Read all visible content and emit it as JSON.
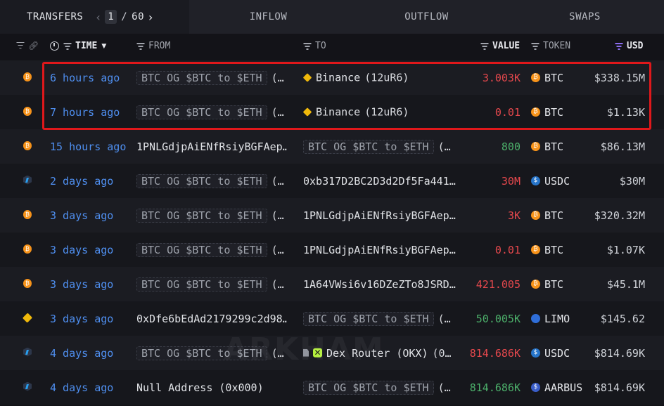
{
  "tabs": {
    "transfers": "TRANSFERS",
    "page_current": "1",
    "page_sep": "/",
    "page_total": "60",
    "inflow": "INFLOW",
    "outflow": "OUTFLOW",
    "swaps": "SWAPS"
  },
  "headers": {
    "time": "TIME",
    "from": "FROM",
    "to": "TO",
    "value": "VALUE",
    "token": "TOKEN",
    "usd": "USD"
  },
  "watermark": "ARKHAM",
  "colors": {
    "time_link": "#4f8ff0",
    "outflow_value": "#e5484d",
    "inflow_value": "#4caf6a",
    "highlight_box": "#e0181b",
    "background": "#131318"
  },
  "rows": [
    {
      "chain": "bitcoin",
      "time": "6 hours ago",
      "from_pill": "BTC OG $BTC to $ETH",
      "from_extra": "(…",
      "to_icon": "binance",
      "to_name": "Binance",
      "to_extra": "(12uR6)",
      "value": "3.003K",
      "value_color": "red",
      "token_icon": "btc",
      "token": "BTC",
      "usd": "$338.15M"
    },
    {
      "chain": "bitcoin",
      "time": "7 hours ago",
      "from_pill": "BTC OG $BTC to $ETH",
      "from_extra": "(…",
      "to_icon": "binance",
      "to_name": "Binance",
      "to_extra": "(12uR6)",
      "value": "0.01",
      "value_color": "red",
      "token_icon": "btc",
      "token": "BTC",
      "usd": "$1.13K"
    },
    {
      "chain": "bitcoin",
      "time": "15 hours ago",
      "from_addr": "1PNLGdjpAiENfRsiyBGFAep…",
      "to_pill": "BTC OG $BTC to $ETH",
      "to_extra": "(…",
      "value": "800",
      "value_color": "green",
      "token_icon": "btc",
      "token": "BTC",
      "usd": "$86.13M"
    },
    {
      "chain": "arbitrum",
      "time": "2 days ago",
      "from_pill": "BTC OG $BTC to $ETH",
      "from_extra": "(…",
      "to_addr": "0xb317D2BC2D3d2Df5Fa441…",
      "value": "30M",
      "value_color": "red",
      "token_icon": "usdc",
      "token": "USDC",
      "usd": "$30M"
    },
    {
      "chain": "bitcoin",
      "time": "3 days ago",
      "from_pill": "BTC OG $BTC to $ETH",
      "from_extra": "(…",
      "to_addr": "1PNLGdjpAiENfRsiyBGFAep…",
      "value": "3K",
      "value_color": "red",
      "token_icon": "btc",
      "token": "BTC",
      "usd": "$320.32M"
    },
    {
      "chain": "bitcoin",
      "time": "3 days ago",
      "from_pill": "BTC OG $BTC to $ETH",
      "from_extra": "(…",
      "to_addr": "1PNLGdjpAiENfRsiyBGFAep…",
      "value": "0.01",
      "value_color": "red",
      "token_icon": "btc",
      "token": "BTC",
      "usd": "$1.07K"
    },
    {
      "chain": "bitcoin",
      "time": "3 days ago",
      "from_pill": "BTC OG $BTC to $ETH",
      "from_extra": "(…",
      "to_addr": "1A64VWsi6v16DZeZTo8JSRD…",
      "value": "421.005",
      "value_color": "red",
      "token_icon": "btc",
      "token": "BTC",
      "usd": "$45.1M"
    },
    {
      "chain": "bsc",
      "time": "3 days ago",
      "from_addr": "0xDfe6bEdAd2179299c2d98…",
      "to_pill": "BTC OG $BTC to $ETH",
      "to_extra": "(…",
      "value": "50.005K",
      "value_color": "green",
      "token_icon": "limo",
      "token": "LIMO",
      "usd": "$145.62"
    },
    {
      "chain": "arbitrum",
      "time": "4 days ago",
      "from_pill": "BTC OG $BTC to $ETH",
      "from_extra": "(…",
      "to_icon": "okx",
      "to_name": "Dex Router (OKX)",
      "to_extra": "(0…",
      "value": "814.686K",
      "value_color": "red",
      "token_icon": "usdc",
      "token": "USDC",
      "usd": "$814.69K"
    },
    {
      "chain": "arbitrum",
      "time": "4 days ago",
      "from_addr": "Null Address (0x000)",
      "to_pill": "BTC OG $BTC to $ETH",
      "to_extra": "(…",
      "value": "814.686K",
      "value_color": "green",
      "token_icon": "aarbus",
      "token": "AARBUS",
      "usd": "$814.69K"
    }
  ]
}
